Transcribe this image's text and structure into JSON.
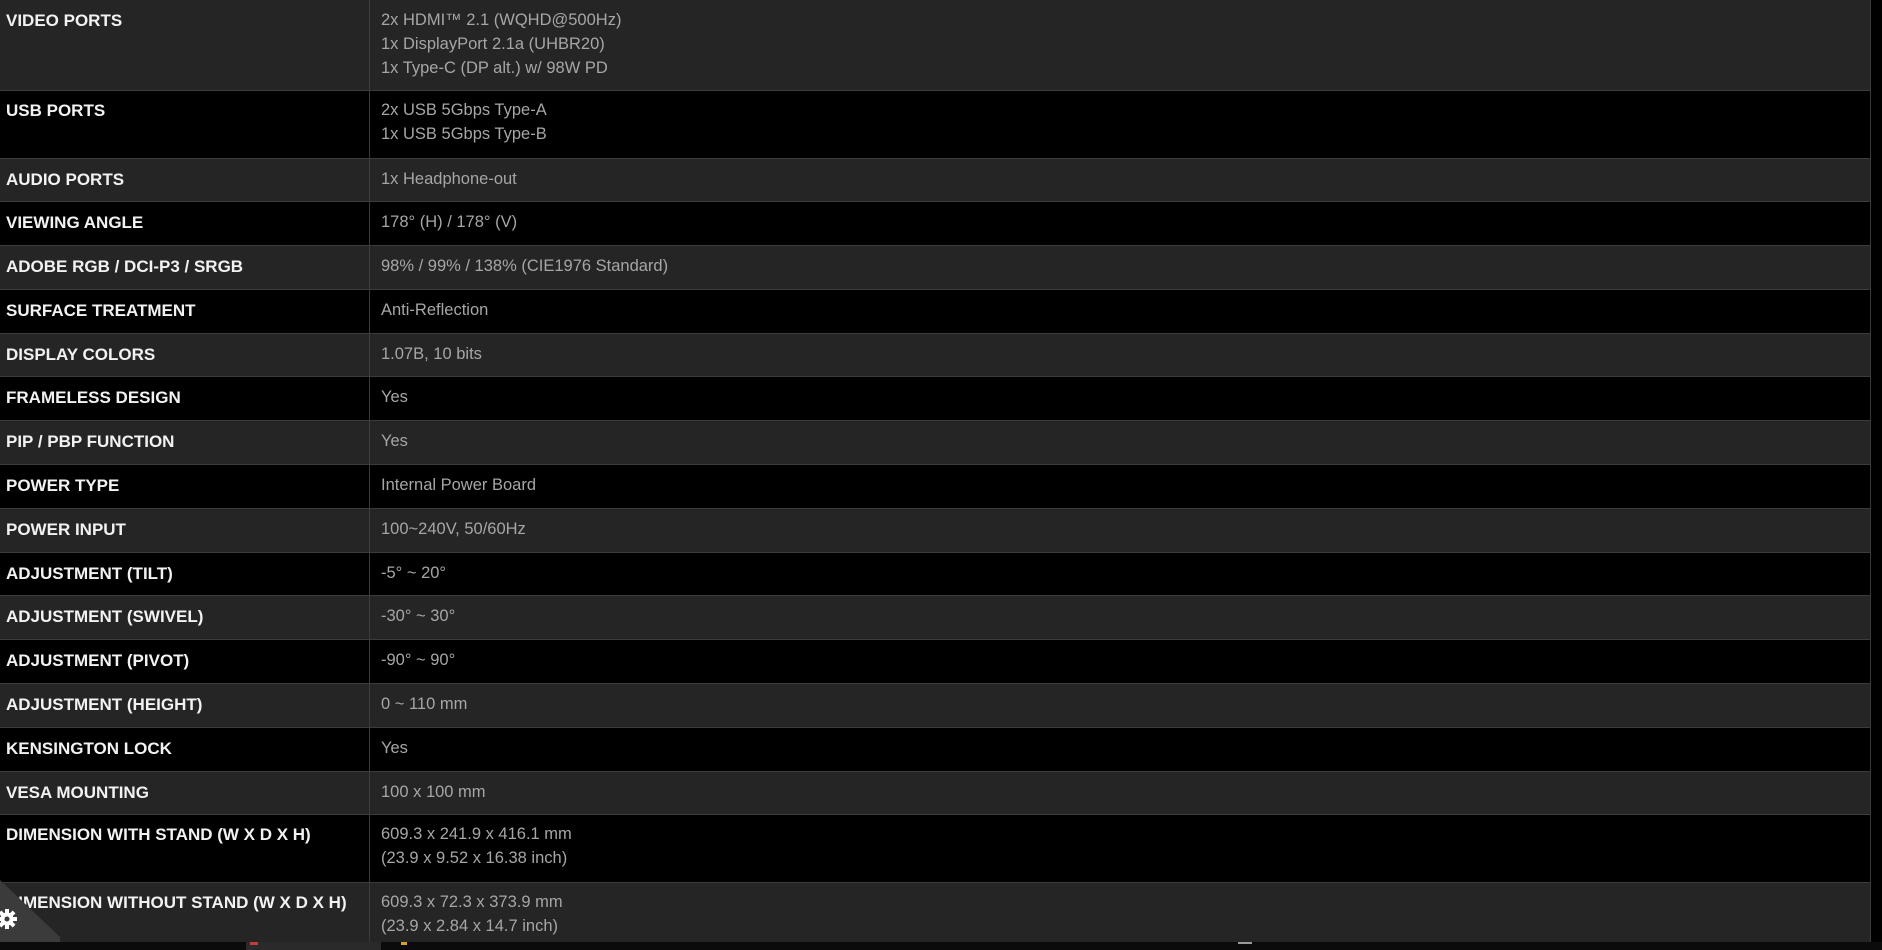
{
  "specs": [
    {
      "label": "VIDEO PORTS",
      "values": [
        "2x HDMI™ 2.1 (WQHD@500Hz)",
        "1x DisplayPort 2.1a (UHBR20)",
        "1x Type-C (DP alt.) w/ 98W PD"
      ]
    },
    {
      "label": "USB PORTS",
      "values": [
        "2x USB 5Gbps Type-A",
        "1x USB 5Gbps Type-B"
      ]
    },
    {
      "label": "AUDIO PORTS",
      "values": [
        "1x Headphone-out"
      ]
    },
    {
      "label": "VIEWING ANGLE",
      "values": [
        "178° (H) / 178° (V)"
      ]
    },
    {
      "label": "ADOBE RGB / DCI-P3 / SRGB",
      "values": [
        "98% / 99% / 138% (CIE1976 Standard)"
      ]
    },
    {
      "label": "SURFACE TREATMENT",
      "values": [
        "Anti-Reflection"
      ]
    },
    {
      "label": "DISPLAY COLORS",
      "values": [
        "1.07B, 10 bits"
      ]
    },
    {
      "label": "FRAMELESS DESIGN",
      "values": [
        "Yes"
      ]
    },
    {
      "label": "PIP / PBP FUNCTION",
      "values": [
        "Yes"
      ]
    },
    {
      "label": "POWER TYPE",
      "values": [
        "Internal Power Board"
      ]
    },
    {
      "label": "POWER INPUT",
      "values": [
        "100~240V, 50/60Hz"
      ]
    },
    {
      "label": "ADJUSTMENT (TILT)",
      "values": [
        "-5° ~ 20°"
      ]
    },
    {
      "label": "ADJUSTMENT (SWIVEL)",
      "values": [
        "-30° ~ 30°"
      ]
    },
    {
      "label": "ADJUSTMENT (PIVOT)",
      "values": [
        "-90° ~ 90°"
      ]
    },
    {
      "label": "ADJUSTMENT (HEIGHT)",
      "values": [
        "0 ~ 110 mm"
      ]
    },
    {
      "label": "KENSINGTON LOCK",
      "values": [
        "Yes"
      ]
    },
    {
      "label": "VESA MOUNTING",
      "values": [
        "100 x 100 mm"
      ]
    },
    {
      "label": "DIMENSION WITH STAND (W X D X H)",
      "values": [
        "609.3 x 241.9 x 416.1 mm",
        "(23.9 x 9.52 x 16.38 inch)"
      ]
    },
    {
      "label": "DIMENSION WITHOUT STAND (W X D X H)",
      "values": [
        "609.3 x 72.3 x 373.9 mm",
        "(23.9 x 2.84 x 14.7 inch)"
      ]
    }
  ],
  "colors": {
    "row_odd": "#252525",
    "row_even": "#000000",
    "label_text": "#f2f2f2",
    "value_text": "#a6a6a6",
    "divider": "#3c3c3c"
  },
  "corner_widget": {
    "icon": "gear-icon"
  }
}
